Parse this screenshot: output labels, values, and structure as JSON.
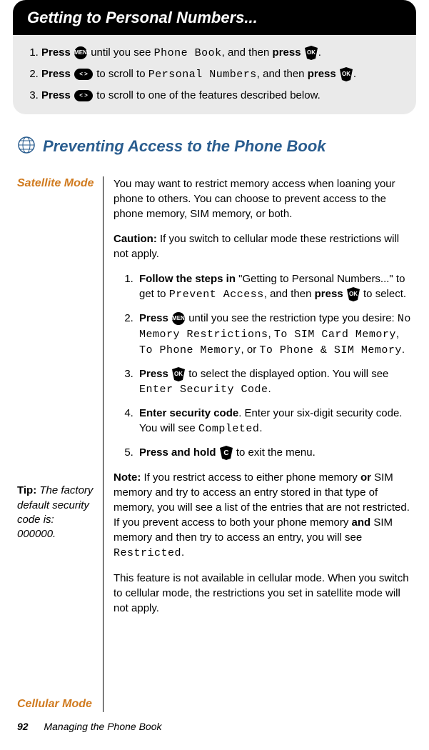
{
  "header": {
    "title": "Getting to Personal Numbers..."
  },
  "steps_top": {
    "items": [
      {
        "pre": "Press ",
        "icon1": "MENU",
        "mid": " until you see ",
        "lcd": "Phone Book",
        "mid2": ", and then ",
        "bold2": "press ",
        "icon2": "OK",
        "tail": "."
      },
      {
        "pre": "Press ",
        "icon1": "< >",
        "mid": " to scroll to ",
        "lcd": "Personal Numbers",
        "mid2": ", and then ",
        "bold2": "press ",
        "icon2": "OK",
        "tail": "."
      },
      {
        "pre": "Press ",
        "icon1": "< >",
        "mid": " to scroll to one of the features described below.",
        "lcd": "",
        "mid2": "",
        "bold2": "",
        "icon2": "",
        "tail": ""
      }
    ]
  },
  "section": {
    "title": "Preventing Access to the Phone Book"
  },
  "side": {
    "satellite": "Satellite Mode",
    "tip_label": "Tip:",
    "tip_text": "The factory default security code is: 000000.",
    "cellular": "Cellular Mode"
  },
  "main": {
    "p1": "You may want to restrict memory access when loaning your phone to others. You can choose to prevent access to the phone memory, SIM memory, or both.",
    "caution_label": "Caution:",
    "caution_text": " If you switch to cellular mode these restrictions will not apply.",
    "step1_a": "Follow the steps in",
    "step1_b": " \"Getting to Personal Numbers...\" to get to ",
    "step1_lcd": "Prevent Access",
    "step1_c": ", and then ",
    "step1_d": "press ",
    "step1_e": " to select.",
    "step2_a": "Press ",
    "step2_b": " until you see the restriction type you desire: ",
    "step2_lcd1": "No Memory Restrictions",
    "step2_sep1": ", ",
    "step2_lcd2": "To SIM Card Memory",
    "step2_sep2": ", ",
    "step2_lcd3": "To Phone Memory",
    "step2_sep3": ", or ",
    "step2_lcd4": "To Phone & SIM Memory",
    "step2_tail": ".",
    "step3_a": "Press ",
    "step3_b": " to select the displayed option. You will see ",
    "step3_lcd": "Enter Security Code",
    "step3_tail": ".",
    "step4_a": "Enter security code",
    "step4_b": ". Enter your six-digit security code. You will see ",
    "step4_lcd": "Completed",
    "step4_tail": ".",
    "step5_a": "Press and hold ",
    "step5_b": " to exit the menu.",
    "note_label": "Note:",
    "note_1": " If you restrict access to either phone memory ",
    "note_or": "or",
    "note_2": " SIM memory and try to access an entry stored in that type of memory, you will see a list of the entries that are not restricted. If you prevent access to both your phone memory ",
    "note_and": "and",
    "note_3": " SIM memory and then try to access an entry, you will see ",
    "note_lcd": "Restricted",
    "note_tail": ".",
    "cellular_text": "This feature is not available in cellular mode. When you switch to cellular mode, the restrictions you set in satellite mode will not apply."
  },
  "footer": {
    "page": "92",
    "crumb": "Managing the Phone Book"
  },
  "icons": {
    "menu": "MENU",
    "ok": "OK",
    "scroll": "< >",
    "c": "C"
  }
}
